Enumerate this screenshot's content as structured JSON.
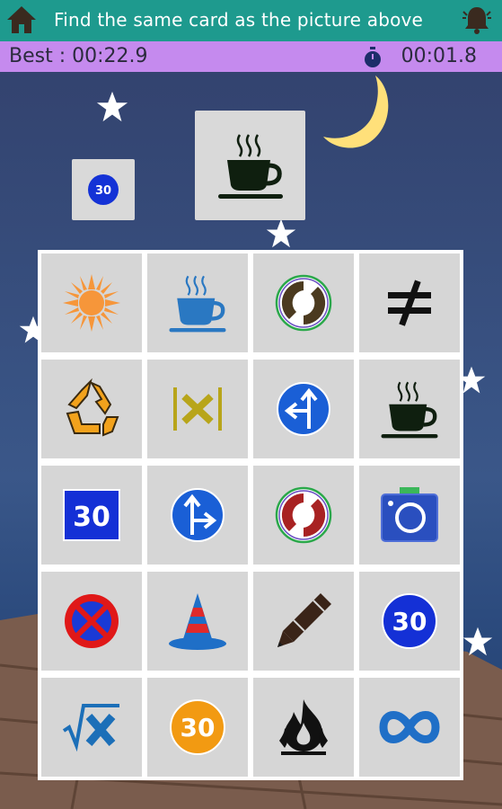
{
  "header": {
    "title": "Find the same card as the picture above",
    "home_icon": "home-icon",
    "bell_icon": "bell-icon"
  },
  "status": {
    "best_label": "Best : 00:22.9",
    "timer": "00:01.8"
  },
  "target": {
    "small_card_symbol": "speed-30-icon",
    "small_card_text": "30",
    "big_card_symbol": "coffee-cup-icon"
  },
  "grid": {
    "rows": [
      [
        "sun-icon",
        "coffee-cup-blue-icon",
        "green-dot-icon",
        "not-equal-icon"
      ],
      [
        "recycle-icon",
        "abs-x-icon",
        "direction-arrows-icon",
        "coffee-cup-icon"
      ],
      [
        "speed-30-square-icon",
        "straight-right-arrow-icon",
        "green-dot-red-icon",
        "camera-icon"
      ],
      [
        "no-parking-icon",
        "traffic-cone-icon",
        "pencil-icon",
        "speed-30-icon"
      ],
      [
        "sqrt-x-icon",
        "speed-30-orange-icon",
        "fire-icon",
        "infinity-icon"
      ]
    ],
    "labels": {
      "speed30": "30",
      "sqrt": "√x",
      "absx": "|x|",
      "notequal": "≠"
    }
  },
  "colors": {
    "topbar": "#1e9a8e",
    "timebar": "#c58aee",
    "card": "#d6d6d6"
  }
}
